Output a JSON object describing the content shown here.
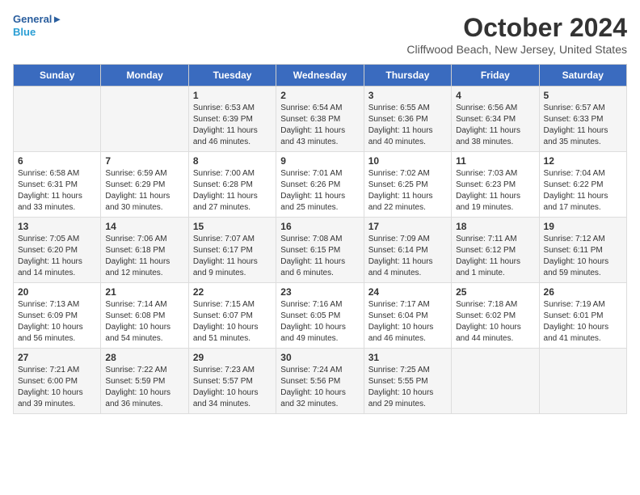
{
  "header": {
    "logo_line1": "General",
    "logo_line2": "Blue",
    "month_title": "October 2024",
    "location": "Cliffwood Beach, New Jersey, United States"
  },
  "days_of_week": [
    "Sunday",
    "Monday",
    "Tuesday",
    "Wednesday",
    "Thursday",
    "Friday",
    "Saturday"
  ],
  "weeks": [
    [
      {
        "num": "",
        "info": ""
      },
      {
        "num": "",
        "info": ""
      },
      {
        "num": "1",
        "info": "Sunrise: 6:53 AM\nSunset: 6:39 PM\nDaylight: 11 hours and 46 minutes."
      },
      {
        "num": "2",
        "info": "Sunrise: 6:54 AM\nSunset: 6:38 PM\nDaylight: 11 hours and 43 minutes."
      },
      {
        "num": "3",
        "info": "Sunrise: 6:55 AM\nSunset: 6:36 PM\nDaylight: 11 hours and 40 minutes."
      },
      {
        "num": "4",
        "info": "Sunrise: 6:56 AM\nSunset: 6:34 PM\nDaylight: 11 hours and 38 minutes."
      },
      {
        "num": "5",
        "info": "Sunrise: 6:57 AM\nSunset: 6:33 PM\nDaylight: 11 hours and 35 minutes."
      }
    ],
    [
      {
        "num": "6",
        "info": "Sunrise: 6:58 AM\nSunset: 6:31 PM\nDaylight: 11 hours and 33 minutes."
      },
      {
        "num": "7",
        "info": "Sunrise: 6:59 AM\nSunset: 6:29 PM\nDaylight: 11 hours and 30 minutes."
      },
      {
        "num": "8",
        "info": "Sunrise: 7:00 AM\nSunset: 6:28 PM\nDaylight: 11 hours and 27 minutes."
      },
      {
        "num": "9",
        "info": "Sunrise: 7:01 AM\nSunset: 6:26 PM\nDaylight: 11 hours and 25 minutes."
      },
      {
        "num": "10",
        "info": "Sunrise: 7:02 AM\nSunset: 6:25 PM\nDaylight: 11 hours and 22 minutes."
      },
      {
        "num": "11",
        "info": "Sunrise: 7:03 AM\nSunset: 6:23 PM\nDaylight: 11 hours and 19 minutes."
      },
      {
        "num": "12",
        "info": "Sunrise: 7:04 AM\nSunset: 6:22 PM\nDaylight: 11 hours and 17 minutes."
      }
    ],
    [
      {
        "num": "13",
        "info": "Sunrise: 7:05 AM\nSunset: 6:20 PM\nDaylight: 11 hours and 14 minutes."
      },
      {
        "num": "14",
        "info": "Sunrise: 7:06 AM\nSunset: 6:18 PM\nDaylight: 11 hours and 12 minutes."
      },
      {
        "num": "15",
        "info": "Sunrise: 7:07 AM\nSunset: 6:17 PM\nDaylight: 11 hours and 9 minutes."
      },
      {
        "num": "16",
        "info": "Sunrise: 7:08 AM\nSunset: 6:15 PM\nDaylight: 11 hours and 6 minutes."
      },
      {
        "num": "17",
        "info": "Sunrise: 7:09 AM\nSunset: 6:14 PM\nDaylight: 11 hours and 4 minutes."
      },
      {
        "num": "18",
        "info": "Sunrise: 7:11 AM\nSunset: 6:12 PM\nDaylight: 11 hours and 1 minute."
      },
      {
        "num": "19",
        "info": "Sunrise: 7:12 AM\nSunset: 6:11 PM\nDaylight: 10 hours and 59 minutes."
      }
    ],
    [
      {
        "num": "20",
        "info": "Sunrise: 7:13 AM\nSunset: 6:09 PM\nDaylight: 10 hours and 56 minutes."
      },
      {
        "num": "21",
        "info": "Sunrise: 7:14 AM\nSunset: 6:08 PM\nDaylight: 10 hours and 54 minutes."
      },
      {
        "num": "22",
        "info": "Sunrise: 7:15 AM\nSunset: 6:07 PM\nDaylight: 10 hours and 51 minutes."
      },
      {
        "num": "23",
        "info": "Sunrise: 7:16 AM\nSunset: 6:05 PM\nDaylight: 10 hours and 49 minutes."
      },
      {
        "num": "24",
        "info": "Sunrise: 7:17 AM\nSunset: 6:04 PM\nDaylight: 10 hours and 46 minutes."
      },
      {
        "num": "25",
        "info": "Sunrise: 7:18 AM\nSunset: 6:02 PM\nDaylight: 10 hours and 44 minutes."
      },
      {
        "num": "26",
        "info": "Sunrise: 7:19 AM\nSunset: 6:01 PM\nDaylight: 10 hours and 41 minutes."
      }
    ],
    [
      {
        "num": "27",
        "info": "Sunrise: 7:21 AM\nSunset: 6:00 PM\nDaylight: 10 hours and 39 minutes."
      },
      {
        "num": "28",
        "info": "Sunrise: 7:22 AM\nSunset: 5:59 PM\nDaylight: 10 hours and 36 minutes."
      },
      {
        "num": "29",
        "info": "Sunrise: 7:23 AM\nSunset: 5:57 PM\nDaylight: 10 hours and 34 minutes."
      },
      {
        "num": "30",
        "info": "Sunrise: 7:24 AM\nSunset: 5:56 PM\nDaylight: 10 hours and 32 minutes."
      },
      {
        "num": "31",
        "info": "Sunrise: 7:25 AM\nSunset: 5:55 PM\nDaylight: 10 hours and 29 minutes."
      },
      {
        "num": "",
        "info": ""
      },
      {
        "num": "",
        "info": ""
      }
    ]
  ]
}
